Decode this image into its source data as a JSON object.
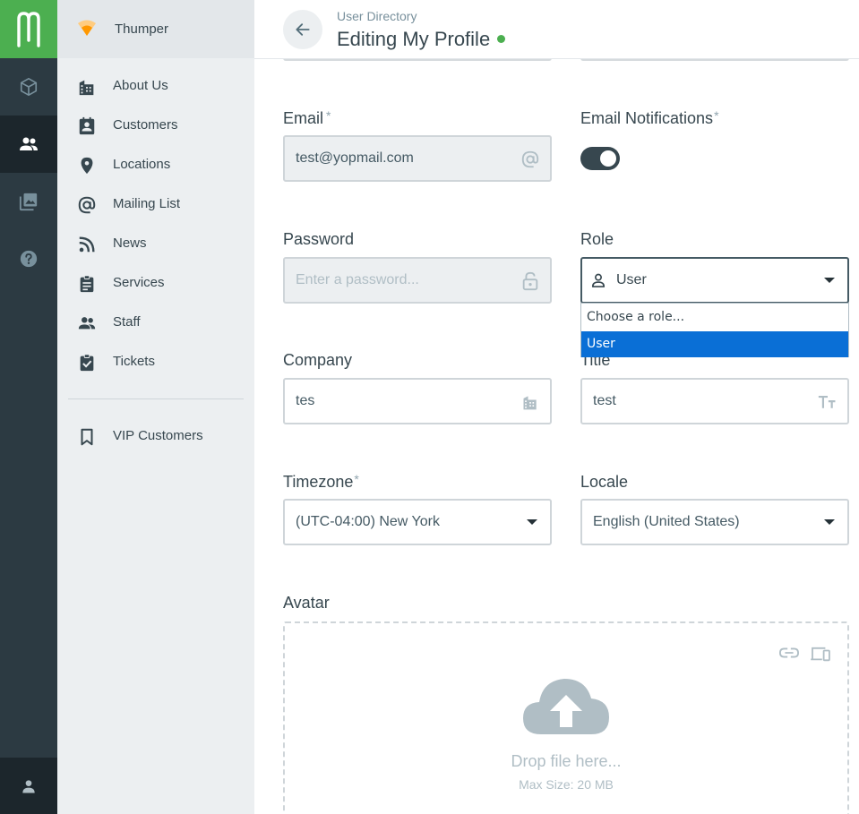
{
  "app": {
    "logo": "M",
    "org_name": "Thumper"
  },
  "rail": {
    "items": [
      {
        "icon": "cube-icon"
      },
      {
        "icon": "people-icon",
        "active": true
      },
      {
        "icon": "photos-icon"
      },
      {
        "icon": "help-icon"
      }
    ],
    "user_icon": "person-icon"
  },
  "sidebar": {
    "items": [
      {
        "label": "About Us",
        "icon": "building-icon"
      },
      {
        "label": "Customers",
        "icon": "contact-badge-icon"
      },
      {
        "label": "Locations",
        "icon": "map-pin-icon"
      },
      {
        "label": "Mailing List",
        "icon": "at-sign-icon"
      },
      {
        "label": "News",
        "icon": "rss-icon"
      },
      {
        "label": "Services",
        "icon": "clipboard-icon"
      },
      {
        "label": "Staff",
        "icon": "people-icon"
      },
      {
        "label": "Tickets",
        "icon": "clipboard-check-icon"
      }
    ],
    "extra_items": [
      {
        "label": "VIP Customers",
        "icon": "bookmark-icon"
      }
    ]
  },
  "header": {
    "breadcrumb": "User Directory",
    "title": "Editing My Profile",
    "status_color": "#4caf50"
  },
  "form": {
    "email": {
      "label": "Email",
      "required_mark": "*",
      "value": "test@yopmail.com"
    },
    "email_notifications": {
      "label": "Email Notifications",
      "required_mark": "*",
      "enabled": true
    },
    "password": {
      "label": "Password",
      "placeholder": "Enter a password..."
    },
    "role": {
      "label": "Role",
      "value": "User",
      "options": [
        "Choose a role...",
        "User"
      ],
      "selected_option": "User"
    },
    "company": {
      "label": "Company",
      "value": "tes"
    },
    "title": {
      "label": "Title",
      "value": "test"
    },
    "timezone": {
      "label": "Timezone",
      "required_mark": "*",
      "value": "(UTC-04:00) New York"
    },
    "locale": {
      "label": "Locale",
      "value": "English (United States)"
    },
    "avatar": {
      "label": "Avatar",
      "drop_text": "Drop file here...",
      "max_size": "Max Size: 20 MB"
    }
  },
  "colors": {
    "brand": "#4caf50",
    "rail": "#2c3a42",
    "selection": "#0a6fd6"
  }
}
